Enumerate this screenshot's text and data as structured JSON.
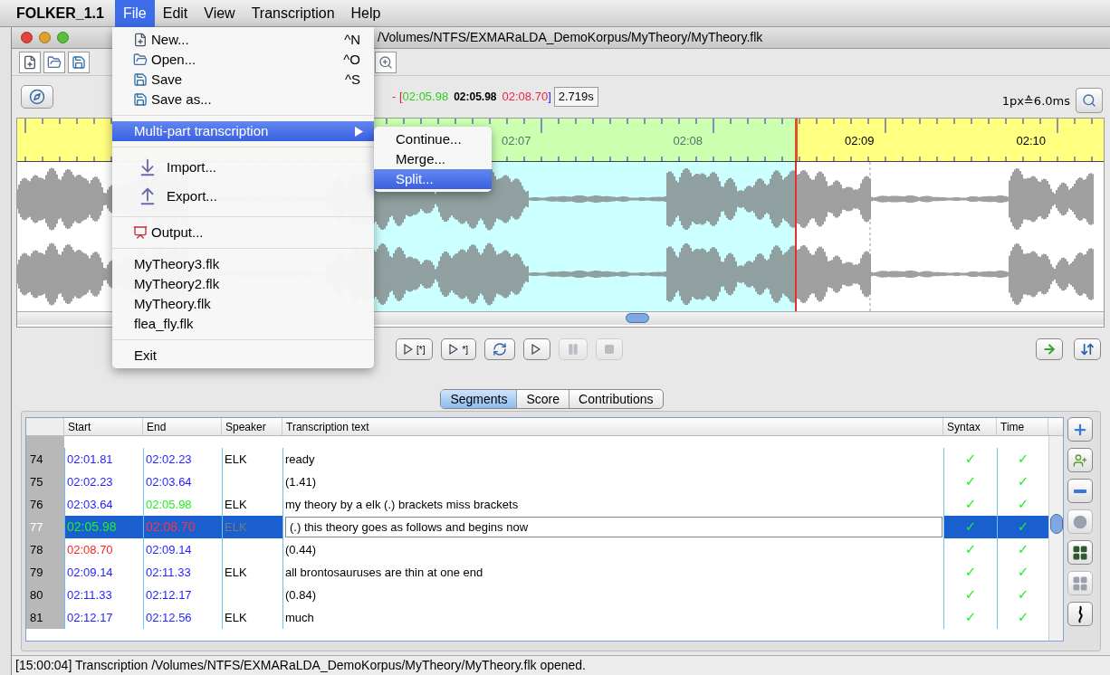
{
  "menubar": {
    "app": "FOLKER_1.1",
    "menus": [
      {
        "label": "File",
        "selected": true
      },
      {
        "label": "Edit",
        "selected": false
      },
      {
        "label": "View",
        "selected": false
      },
      {
        "label": "Transcription",
        "selected": false
      },
      {
        "label": "Help",
        "selected": false
      }
    ]
  },
  "window": {
    "title": "/Volumes/NTFS/EXMARaLDA_DemoKorpus/MyTheory/MyTheory.flk"
  },
  "selection": {
    "open": "- [",
    "start": "02:05.98",
    "current": "02:05.98",
    "end": "02:08.70",
    "close": "]",
    "length": "2.719s"
  },
  "zoom_label": "1px≙6.0ms",
  "ruler": {
    "labels": [
      "02:07",
      "02:08",
      "02:09",
      "02:10"
    ]
  },
  "playback_buttons": [
    {
      "kind": "play-range",
      "label": "[*]",
      "disabled": false
    },
    {
      "kind": "play-end",
      "label": "*]",
      "disabled": false
    },
    {
      "kind": "loop",
      "disabled": false
    },
    {
      "kind": "play",
      "disabled": false
    },
    {
      "kind": "pause",
      "disabled": true
    },
    {
      "kind": "stop",
      "disabled": true
    }
  ],
  "tabs": [
    {
      "label": "Segments",
      "selected": true
    },
    {
      "label": "Score",
      "selected": false
    },
    {
      "label": "Contributions",
      "selected": false
    }
  ],
  "table": {
    "columns": [
      "Start",
      "End",
      "Speaker",
      "Transcription text",
      "Syntax",
      "Time"
    ],
    "rows": [
      {
        "number": "74",
        "start": {
          "text": "02:01.81",
          "color": "#1f1fff"
        },
        "end": {
          "text": "02:02.23",
          "color": "#1f1fff"
        },
        "speaker": "ELK",
        "text": "ready",
        "syntax": "✓",
        "time": "✓",
        "selected": false
      },
      {
        "number": "75",
        "start": {
          "text": "02:02.23",
          "color": "#1f1fff"
        },
        "end": {
          "text": "02:03.64",
          "color": "#1f1fff"
        },
        "text": "(1.41)",
        "syntax": "✓",
        "time": "✓",
        "selected": false
      },
      {
        "number": "76",
        "start": {
          "text": "02:03.64",
          "color": "#1f1fff"
        },
        "end": {
          "text": "02:05.98",
          "color": "#22ee22"
        },
        "speaker": "ELK",
        "text": "my theory by a elk (.) brackets miss brackets",
        "syntax": "✓",
        "time": "✓",
        "selected": false
      },
      {
        "number": "77",
        "start": {
          "text": "02:05.98",
          "color": "#22ee22"
        },
        "end": {
          "text": "02:08.70",
          "color": "#ff3344"
        },
        "speaker": "ELK",
        "text": "(.) this theory goes as follows and begins now",
        "syntax": "✓",
        "time": "✓",
        "selected": true
      },
      {
        "number": "78",
        "start": {
          "text": "02:08.70",
          "color": "#ff2222"
        },
        "end": {
          "text": "02:09.14",
          "color": "#1f1fff"
        },
        "text": "(0.44)",
        "syntax": "✓",
        "time": "✓",
        "selected": false
      },
      {
        "number": "79",
        "start": {
          "text": "02:09.14",
          "color": "#1f1fff"
        },
        "end": {
          "text": "02:11.33",
          "color": "#1f1fff"
        },
        "speaker": "ELK",
        "text": "all brontosauruses are thin at one end",
        "syntax": "✓",
        "time": "✓",
        "selected": false
      },
      {
        "number": "80",
        "start": {
          "text": "02:11.33",
          "color": "#1f1fff"
        },
        "end": {
          "text": "02:12.17",
          "color": "#1f1fff"
        },
        "text": "(0.84)",
        "syntax": "✓",
        "time": "✓",
        "selected": false
      },
      {
        "number": "81",
        "start": {
          "text": "02:12.17",
          "color": "#1f1fff"
        },
        "end": {
          "text": "02:12.56",
          "color": "#1f1fff"
        },
        "speaker": "ELK",
        "text": "much",
        "syntax": "✓",
        "time": "✓",
        "selected": false
      }
    ]
  },
  "side_buttons": [
    {
      "kind": "add",
      "disabled": false
    },
    {
      "kind": "add-speaker",
      "disabled": false
    },
    {
      "kind": "remove",
      "disabled": false
    },
    {
      "kind": "circle",
      "disabled": true
    },
    {
      "kind": "split",
      "disabled": false
    },
    {
      "kind": "merge",
      "disabled": true
    },
    {
      "kind": "wave",
      "disabled": false
    }
  ],
  "status_bar": "[15:00:04] Transcription /Volumes/NTFS/EXMARaLDA_DemoKorpus/MyTheory/MyTheory.flk opened.",
  "file_menu": {
    "items": [
      {
        "kind": "new",
        "label": "New...",
        "shortcut": "^N"
      },
      {
        "kind": "open",
        "label": "Open...",
        "shortcut": "^O"
      },
      {
        "kind": "save",
        "label": "Save",
        "shortcut": "^S"
      },
      {
        "kind": "saveas",
        "label": "Save as..."
      },
      {
        "kind": "separator"
      },
      {
        "kind": "submenu",
        "label": "Multi-part transcription",
        "selected": true
      },
      {
        "kind": "separator"
      },
      {
        "kind": "import",
        "label": "Import..."
      },
      {
        "kind": "export",
        "label": "Export..."
      },
      {
        "kind": "separator"
      },
      {
        "kind": "output",
        "label": "Output..."
      },
      {
        "kind": "separator"
      },
      {
        "kind": "recent",
        "label": "MyTheory3.flk"
      },
      {
        "kind": "recent",
        "label": "MyTheory2.flk"
      },
      {
        "kind": "recent",
        "label": "MyTheory.flk"
      },
      {
        "kind": "recent",
        "label": "flea_fly.flk"
      },
      {
        "kind": "separator"
      },
      {
        "kind": "exit",
        "label": "Exit"
      }
    ]
  },
  "submenu": {
    "items": [
      {
        "label": "Continue...",
        "selected": false
      },
      {
        "label": "Merge...",
        "selected": false
      },
      {
        "label": "Split...",
        "selected": true
      }
    ]
  }
}
